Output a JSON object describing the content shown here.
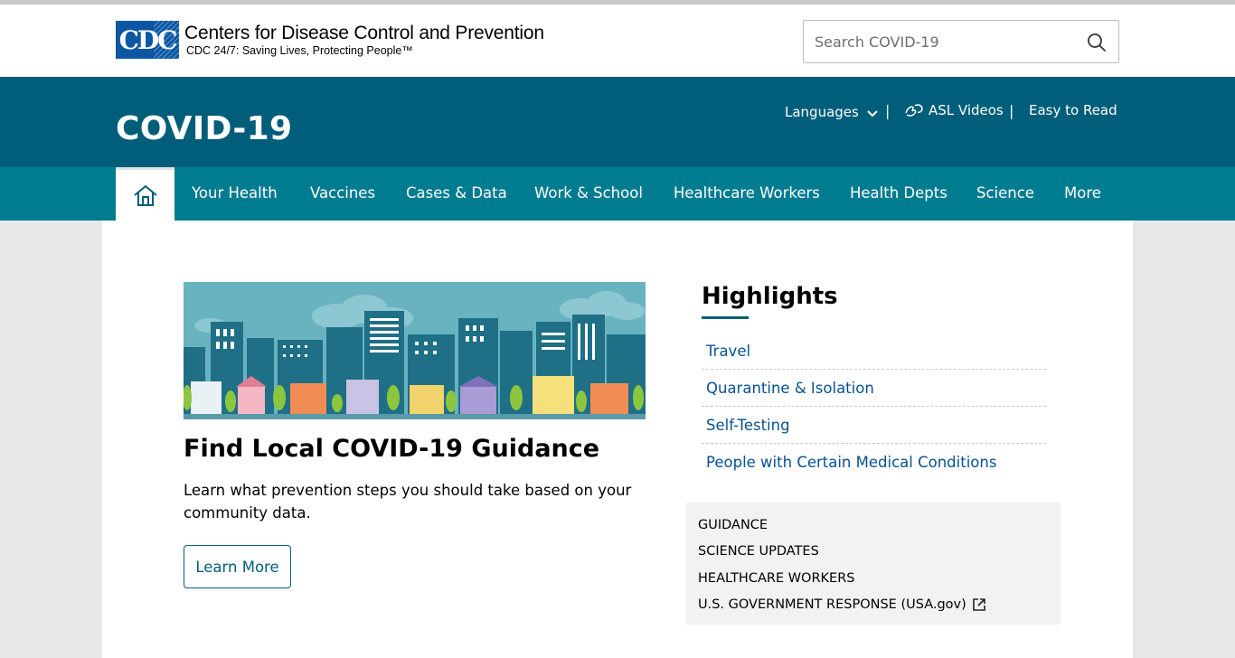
{
  "header": {
    "logo_abbr": "CDC",
    "logo_title": "Centers for Disease Control and Prevention",
    "logo_tagline": "CDC 24/7: Saving Lives, Protecting People™",
    "search_placeholder": "Search COVID-19"
  },
  "band": {
    "title": "COVID-19",
    "languages_label": "Languages",
    "asl_label": "ASL Videos",
    "easy_label": "Easy to Read",
    "separator": "|"
  },
  "nav": {
    "items": [
      "Your Health",
      "Vaccines",
      "Cases & Data",
      "Work & School",
      "Healthcare Workers",
      "Health Depts",
      "Science",
      "More"
    ]
  },
  "feature": {
    "title": "Find Local COVID-19 Guidance",
    "description": "Learn what prevention steps you should take based on your community data.",
    "button_label": "Learn More"
  },
  "highlights": {
    "title": "Highlights",
    "links": [
      "Travel",
      "Quarantine & Isolation",
      "Self-Testing",
      "People with Certain Medical Conditions"
    ]
  },
  "quick_links": [
    "GUIDANCE",
    "SCIENCE UPDATES",
    "HEALTHCARE WORKERS",
    "U.S. GOVERNMENT RESPONSE (USA.gov)"
  ],
  "colors": {
    "band": "#005e7a",
    "nav": "#007c91",
    "link": "#075290"
  }
}
